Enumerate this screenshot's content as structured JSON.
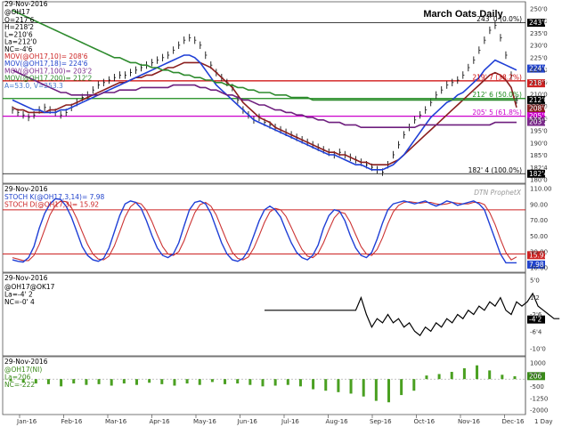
{
  "chart_data": [
    {
      "type": "line",
      "panel": "price",
      "title": "March Oats Daily",
      "date_text": "29-Nov-2016",
      "symbol": "@OH17",
      "ohlc_labels": [
        "O=217'6",
        "H=218'2",
        "L=210'6",
        "La=212'0",
        "NC=-4'6"
      ],
      "ma_labels": [
        {
          "text": "MOV(@OH17,10)= 208'6",
          "color": "#cc2222"
        },
        {
          "text": "MOV(@OH17,18)= 224'6",
          "color": "#2244cc"
        },
        {
          "text": "MOV(@OH17,100)= 203'2",
          "color": "#7a2a8a"
        },
        {
          "text": "MOV(@OH17,200)= 212'2",
          "color": "#2a8a2a"
        }
      ],
      "range_label": "A=53.0, V=253.3",
      "ylim": [
        180,
        250
      ],
      "y_ticks": [
        "250'0",
        "243'0",
        "235'0",
        "230'0",
        "225'0",
        "220'0",
        "215'0",
        "210'0",
        "205'0",
        "200'0",
        "195'0",
        "190'0",
        "185'0",
        "182'4",
        "180'0"
      ],
      "fib_levels": [
        {
          "value": 243.0,
          "label": "243' 0 (0.0%)",
          "color": "#000000"
        },
        {
          "value": 219.7,
          "label": "219' 7 (38.2%)",
          "color": "#cc0000"
        },
        {
          "value": 212.6,
          "label": "212' 6 (50.0%)",
          "color": "#1a8a1a"
        },
        {
          "value": 205.5,
          "label": "205' 5 (61.8%)",
          "color": "#cc00cc"
        },
        {
          "value": 182.4,
          "label": "182' 4 (100.0%)",
          "color": "#000000"
        }
      ],
      "price_markers": [
        {
          "text": "243'0",
          "value": 243.0,
          "bg": "#000000"
        },
        {
          "text": "224'6",
          "value": 224.6,
          "bg": "#2244cc"
        },
        {
          "text": "218'7",
          "value": 218.7,
          "bg": "#cc2222"
        },
        {
          "text": "212'0",
          "value": 212.0,
          "bg": "#000000"
        },
        {
          "text": "208'6",
          "value": 208.6,
          "bg": "#8a2222"
        },
        {
          "text": "205'5",
          "value": 205.5,
          "bg": "#cc00cc"
        },
        {
          "text": "203'2",
          "value": 203.2,
          "bg": "#7a2a8a"
        },
        {
          "text": "182'4",
          "value": 182.4,
          "bg": "#000000"
        }
      ],
      "watermark": "DTN ProphetX",
      "price_series": [
        208,
        207,
        206,
        205,
        206,
        208,
        209,
        208,
        207,
        206,
        207,
        209,
        211,
        213,
        214,
        216,
        218,
        219,
        220,
        221,
        222,
        222,
        223,
        224,
        225,
        226,
        227,
        228,
        229,
        230,
        232,
        234,
        236,
        237,
        236,
        234,
        230,
        226,
        223,
        221,
        219,
        217,
        212,
        208,
        206,
        204,
        205,
        203,
        202,
        201,
        200,
        199,
        198,
        197,
        196,
        195,
        194,
        193,
        192,
        191,
        190,
        191,
        190,
        189,
        188,
        187,
        186,
        185,
        184,
        183,
        186,
        190,
        194,
        198,
        201,
        204,
        206,
        208,
        211,
        214,
        216,
        218,
        219,
        220,
        222,
        225,
        228,
        232,
        236,
        240,
        242,
        237,
        230,
        222,
        212
      ],
      "ma_series": [
        {
          "name": "MOV 10",
          "color": "#8a1e1e",
          "values": [
            209,
            208,
            208,
            207,
            207,
            207,
            207,
            208,
            208,
            209,
            210,
            210,
            211,
            212,
            213,
            214,
            215,
            216,
            217,
            218,
            219,
            219,
            220,
            221,
            221,
            222,
            222,
            223,
            224,
            225,
            225,
            226,
            227,
            227,
            227,
            227,
            226,
            225,
            223,
            221,
            219,
            217,
            214,
            211,
            209,
            207,
            205,
            204,
            203,
            201,
            200,
            199,
            198,
            197,
            196,
            195,
            194,
            193,
            192,
            191,
            191,
            190,
            190,
            189,
            188,
            187,
            187,
            186,
            186,
            186,
            186,
            187,
            188,
            190,
            192,
            194,
            196,
            198,
            200,
            202,
            204,
            206,
            208,
            210,
            212,
            214,
            216,
            218,
            220,
            222,
            223,
            222,
            220,
            217,
            209
          ]
        },
        {
          "name": "MOV 18",
          "color": "#1f3fd6",
          "values": [
            212,
            211,
            210,
            209,
            208,
            208,
            207,
            207,
            207,
            208,
            208,
            209,
            210,
            211,
            212,
            213,
            214,
            215,
            216,
            217,
            218,
            219,
            220,
            221,
            222,
            223,
            224,
            225,
            226,
            227,
            228,
            229,
            230,
            230,
            229,
            227,
            224,
            221,
            218,
            216,
            214,
            212,
            210,
            208,
            206,
            204,
            203,
            202,
            201,
            200,
            199,
            198,
            197,
            196,
            195,
            194,
            193,
            192,
            191,
            190,
            190,
            189,
            188,
            187,
            186,
            186,
            185,
            184,
            184,
            184,
            185,
            186,
            188,
            190,
            193,
            196,
            199,
            202,
            205,
            207,
            209,
            211,
            212,
            214,
            215,
            217,
            219,
            221,
            224,
            226,
            228,
            227,
            226,
            225,
            224
          ]
        },
        {
          "name": "MOV 100",
          "color": "#6e1f7e",
          "values": [
            224,
            223,
            222,
            221,
            220,
            219,
            218,
            217,
            216,
            215,
            215,
            214,
            214,
            214,
            214,
            214,
            214,
            215,
            215,
            215,
            216,
            216,
            216,
            216,
            217,
            217,
            217,
            217,
            217,
            217,
            218,
            218,
            218,
            218,
            218,
            217,
            217,
            216,
            216,
            215,
            214,
            214,
            213,
            212,
            212,
            211,
            210,
            210,
            209,
            208,
            208,
            207,
            207,
            206,
            206,
            205,
            205,
            204,
            204,
            203,
            203,
            203,
            202,
            202,
            202,
            201,
            201,
            201,
            201,
            201,
            201,
            201,
            201,
            201,
            201,
            201,
            202,
            202,
            202,
            202,
            202,
            202,
            202,
            202,
            202,
            202,
            202,
            202,
            202,
            202,
            203,
            203,
            203,
            203,
            203
          ]
        },
        {
          "name": "MOV 200",
          "color": "#2e8b2e",
          "values": [
            248,
            247,
            246,
            245,
            244,
            243,
            242,
            241,
            240,
            239,
            238,
            237,
            236,
            235,
            234,
            233,
            232,
            231,
            230,
            229,
            229,
            228,
            227,
            227,
            226,
            226,
            225,
            225,
            224,
            224,
            223,
            223,
            222,
            222,
            221,
            221,
            220,
            220,
            219,
            219,
            218,
            218,
            217,
            217,
            216,
            216,
            215,
            215,
            215,
            214,
            214,
            214,
            213,
            213,
            213,
            213,
            212,
            212,
            212,
            212,
            212,
            212,
            212,
            212,
            212,
            212,
            212,
            212,
            212,
            212,
            212,
            212,
            212,
            212,
            212,
            212,
            212,
            212,
            212,
            212,
            212,
            212,
            212,
            212,
            212,
            212,
            212,
            212,
            212,
            212,
            212,
            212,
            212,
            212,
            212
          ]
        }
      ]
    },
    {
      "type": "line",
      "panel": "stochastic",
      "date_text": "29-Nov-2016",
      "labels": [
        {
          "text": "STOCH K(@OH17,3,14)= 7.98",
          "color": "#2244cc"
        },
        {
          "text": "STOCH D(@OH17,3)= 15.92",
          "color": "#cc2222"
        }
      ],
      "ylim": [
        0,
        110
      ],
      "y_ticks": [
        "110.00",
        "90.00",
        "70.00",
        "50.00",
        "30.00",
        "10.00"
      ],
      "reference_lines": [
        80,
        20
      ],
      "markers": [
        {
          "text": "15.92",
          "bg": "#cc2222"
        },
        {
          "text": "7.98",
          "bg": "#2244cc"
        }
      ],
      "k_series": [
        12,
        10,
        9,
        15,
        30,
        55,
        75,
        88,
        95,
        94,
        85,
        70,
        50,
        30,
        18,
        12,
        10,
        14,
        28,
        50,
        72,
        88,
        92,
        90,
        82,
        65,
        45,
        28,
        18,
        15,
        20,
        35,
        58,
        80,
        90,
        92,
        88,
        75,
        55,
        35,
        20,
        12,
        10,
        14,
        25,
        45,
        65,
        80,
        85,
        80,
        70,
        52,
        35,
        22,
        15,
        12,
        18,
        32,
        55,
        72,
        80,
        78,
        65,
        45,
        28,
        18,
        15,
        22,
        40,
        62,
        80,
        88,
        90,
        92,
        90,
        88,
        90,
        92,
        88,
        85,
        88,
        92,
        90,
        86,
        88,
        90,
        92,
        88,
        80,
        60,
        40,
        20,
        8,
        8,
        8
      ],
      "d_series": [
        15,
        13,
        11,
        11,
        18,
        33,
        53,
        73,
        86,
        92,
        91,
        83,
        68,
        50,
        33,
        20,
        13,
        12,
        17,
        31,
        50,
        70,
        84,
        90,
        88,
        79,
        64,
        46,
        30,
        20,
        18,
        23,
        38,
        58,
        76,
        87,
        90,
        85,
        73,
        55,
        37,
        22,
        14,
        12,
        16,
        28,
        45,
        63,
        77,
        82,
        80,
        71,
        56,
        40,
        26,
        17,
        15,
        21,
        35,
        53,
        69,
        77,
        75,
        63,
        46,
        30,
        20,
        18,
        26,
        42,
        61,
        77,
        86,
        90,
        91,
        90,
        89,
        90,
        90,
        88,
        87,
        88,
        90,
        89,
        88,
        88,
        90,
        90,
        87,
        76,
        60,
        40,
        22,
        12,
        16
      ]
    },
    {
      "type": "line",
      "panel": "spread",
      "date_text": "29-Nov-2016",
      "labels": [
        "@OH17@OK17",
        "La=-4' 2",
        "NC=-0' 4"
      ],
      "ylim": [
        -12,
        6
      ],
      "y_ticks": [
        "5'0",
        "1'2",
        "-2'6",
        "-6'4",
        "-10'0"
      ],
      "marker": {
        "text": "-4'2",
        "bg": "#000000"
      },
      "series": [
        {
          "name": "@OH17@OK17",
          "values": [
            null,
            null,
            null,
            null,
            null,
            null,
            null,
            null,
            null,
            null,
            null,
            null,
            null,
            null,
            null,
            null,
            null,
            null,
            null,
            null,
            null,
            null,
            null,
            null,
            null,
            null,
            null,
            null,
            null,
            null,
            null,
            null,
            null,
            null,
            null,
            null,
            null,
            null,
            null,
            null,
            null,
            null,
            null,
            null,
            null,
            null,
            null,
            -2,
            -2,
            -2,
            -2,
            -2,
            -2,
            -2,
            -2,
            -2,
            -2,
            -2,
            -2,
            -2,
            -2,
            -2,
            -2,
            -2,
            -2,
            1,
            -3,
            -6,
            -4,
            -5,
            -3,
            -5,
            -4,
            -6,
            -5,
            -7,
            -8,
            -6,
            -7,
            -5,
            -6,
            -4,
            -5,
            -3,
            -4,
            -2,
            -3,
            -1,
            -2,
            0,
            -1,
            1,
            -2,
            -3,
            0,
            -1,
            0,
            2,
            -1,
            -2,
            -3,
            -4,
            -4
          ]
        }
      ]
    },
    {
      "type": "bar",
      "panel": "open_interest",
      "date_text": "29-Nov-2016",
      "labels": [
        "@OH17(NI)",
        "La=206",
        "NC=-222"
      ],
      "ylim": [
        -2200,
        1300
      ],
      "y_ticks": [
        "1000",
        "250",
        "-500",
        "-1250",
        "-2000"
      ],
      "marker": {
        "text": "206",
        "bg": "#3a8a1a"
      },
      "values": [
        -150,
        -250,
        -300,
        -350,
        -500,
        -300,
        -400,
        -350,
        -450,
        -300,
        -400,
        -250,
        -350,
        -450,
        -300,
        -400,
        -200,
        -350,
        -300,
        -400,
        -500,
        -450,
        -400,
        -500,
        -700,
        -800,
        -900,
        -1000,
        -1200,
        -1500,
        -1600,
        -1100,
        -800,
        250,
        350,
        500,
        750,
        950,
        600,
        300,
        200
      ]
    }
  ],
  "x_axis": {
    "ticks": [
      "Jan-16",
      "Feb-16",
      "Mar-16",
      "Apr-16",
      "May-16",
      "Jun-16",
      "Jul-16",
      "Aug-16",
      "Sep-16",
      "Oct-16",
      "Nov-16",
      "Dec-16"
    ],
    "interval_label": "1 Day"
  }
}
